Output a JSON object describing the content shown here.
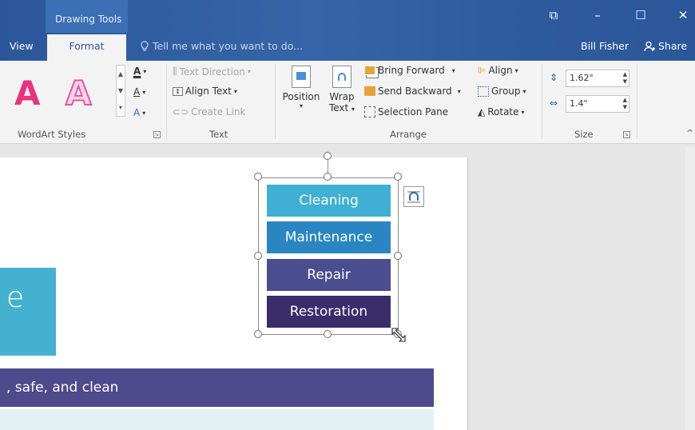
{
  "titlebar": {
    "context_tab": "Drawing Tools",
    "tabs": [
      {
        "label": "View"
      },
      {
        "label": "Format"
      }
    ],
    "tell_me_placeholder": "Tell me what you want to do...",
    "user": "Bill Fisher",
    "share": "Share",
    "window_buttons": {
      "restore": "⧉",
      "minimize": "–",
      "maximize": "☐",
      "close": "✕"
    }
  },
  "ribbon": {
    "wordart": {
      "letters": [
        "A",
        "A"
      ],
      "group_label": "WordArt Styles",
      "colors": {
        "pink_fill": "#e8337f",
        "outline_pink": "#f39cc8"
      }
    },
    "text_group": {
      "text_direction": "Text Direction",
      "align_text": "Align Text",
      "create_link": "Create Link",
      "group_label": "Text"
    },
    "arrange": {
      "position": "Position",
      "wrap": "Wrap",
      "wrap_text": "Text",
      "bring_forward": "Bring Forward",
      "send_backward": "Send Backward",
      "selection_pane": "Selection Pane",
      "align": "Align",
      "group": "Group",
      "rotate": "Rotate",
      "group_label": "Arrange"
    },
    "size": {
      "height": "1.62\"",
      "width": "1.4\"",
      "group_label": "Size"
    }
  },
  "document": {
    "cyan_letter": "e",
    "band_text": ", safe, and clean",
    "shapes": [
      {
        "label": "Cleaning",
        "color": "#3fb0d3"
      },
      {
        "label": "Maintenance",
        "color": "#2a86c3"
      },
      {
        "label": "Repair",
        "color": "#4a4e8f"
      },
      {
        "label": "Restoration",
        "color": "#3b2d6b"
      }
    ]
  }
}
